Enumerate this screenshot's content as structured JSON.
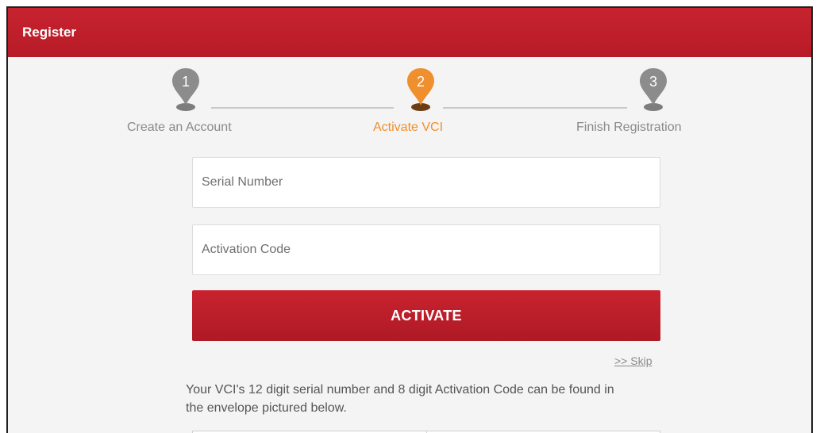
{
  "header": {
    "title": "Register"
  },
  "stepper": {
    "steps": [
      {
        "number": "1",
        "label": "Create an Account",
        "state": "done"
      },
      {
        "number": "2",
        "label": "Activate VCI",
        "state": "active"
      },
      {
        "number": "3",
        "label": "Finish Registration",
        "state": "pending"
      }
    ]
  },
  "form": {
    "serial": {
      "placeholder": "Serial Number",
      "value": ""
    },
    "activation": {
      "placeholder": "Activation Code",
      "value": ""
    },
    "activate_label": "ACTIVATE",
    "skip_label": ">> Skip"
  },
  "hint": "Your VCI's 12 digit serial number and 8 digit Activation Code can be found in the envelope pictured below.",
  "colors": {
    "brand_red": "#c21f2b",
    "active_orange": "#f08f2d",
    "pending_gray": "#8c8c8c"
  }
}
